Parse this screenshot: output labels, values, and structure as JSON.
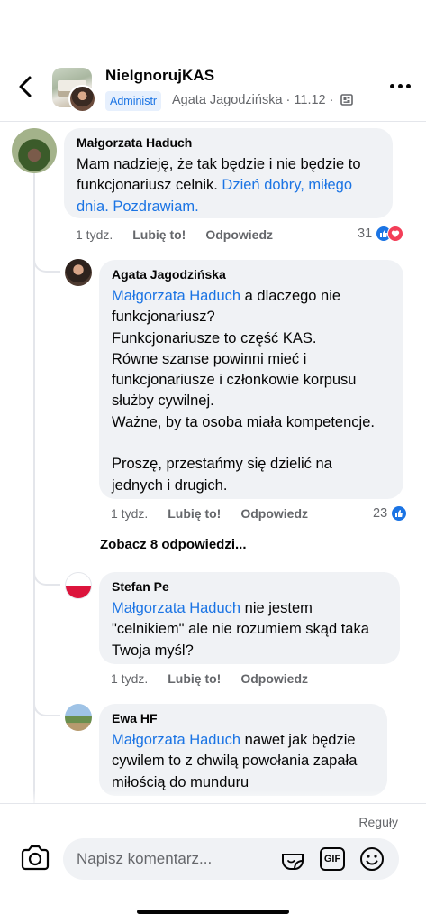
{
  "header": {
    "group_name": "NieIgnorujKAS",
    "admin_badge": "Administr",
    "post_meta": "Agata Jagodzińska · 11.12 ·"
  },
  "comments": [
    {
      "author": "Małgorzata Haduch",
      "text_before": "Mam nadzieję, że tak będzie i nie będzie to funkcjonariusz celnik. ",
      "link_text": "Dzień dobry, miłego dnia. Pozdrawiam.",
      "time": "1 tydz.",
      "like": "Lubię to!",
      "reply": "Odpowiedz",
      "reaction_count": "31"
    }
  ],
  "replies": [
    {
      "author": "Agata Jagodzińska",
      "mention": "Małgorzata Haduch",
      "text": " a dlaczego nie\nfunkcjonariusz?\nFunkcjonariusze to część KAS.\nRówne szanse powinni mieć i\nfunkcjonariusze i członkowie korpusu\nsłużby cywilnej.\nWażne, by ta osoba miała kompetencje.\n\nProszę, przestańmy się dzielić na\njednych i drugich.",
      "time": "1 tydz.",
      "like": "Lubię to!",
      "reply": "Odpowiedz",
      "reaction_count": "23"
    },
    {
      "author": "Stefan Pe",
      "mention": "Małgorzata Haduch",
      "text": " nie jestem\n\"celnikiem\" ale nie rozumiem skąd taka\nTwoja myśl?",
      "time": "1 tydz.",
      "like": "Lubię to!",
      "reply": "Odpowiedz"
    },
    {
      "author": "Ewa HF",
      "mention": "Małgorzata Haduch",
      "text": " nawet jak będzie\ncywilem to z chwilą powołania zapała\nmiłością do munduru"
    }
  ],
  "see_more_replies": "Zobacz 8 odpowiedzi...",
  "footer": {
    "rules": "Reguły",
    "input_placeholder": "Napisz komentarz...",
    "gif_label": "GIF"
  },
  "colors": {
    "accent": "#1b74e4",
    "bubble": "#f0f2f5",
    "secondary_text": "#65676b",
    "love": "#f33e58"
  }
}
